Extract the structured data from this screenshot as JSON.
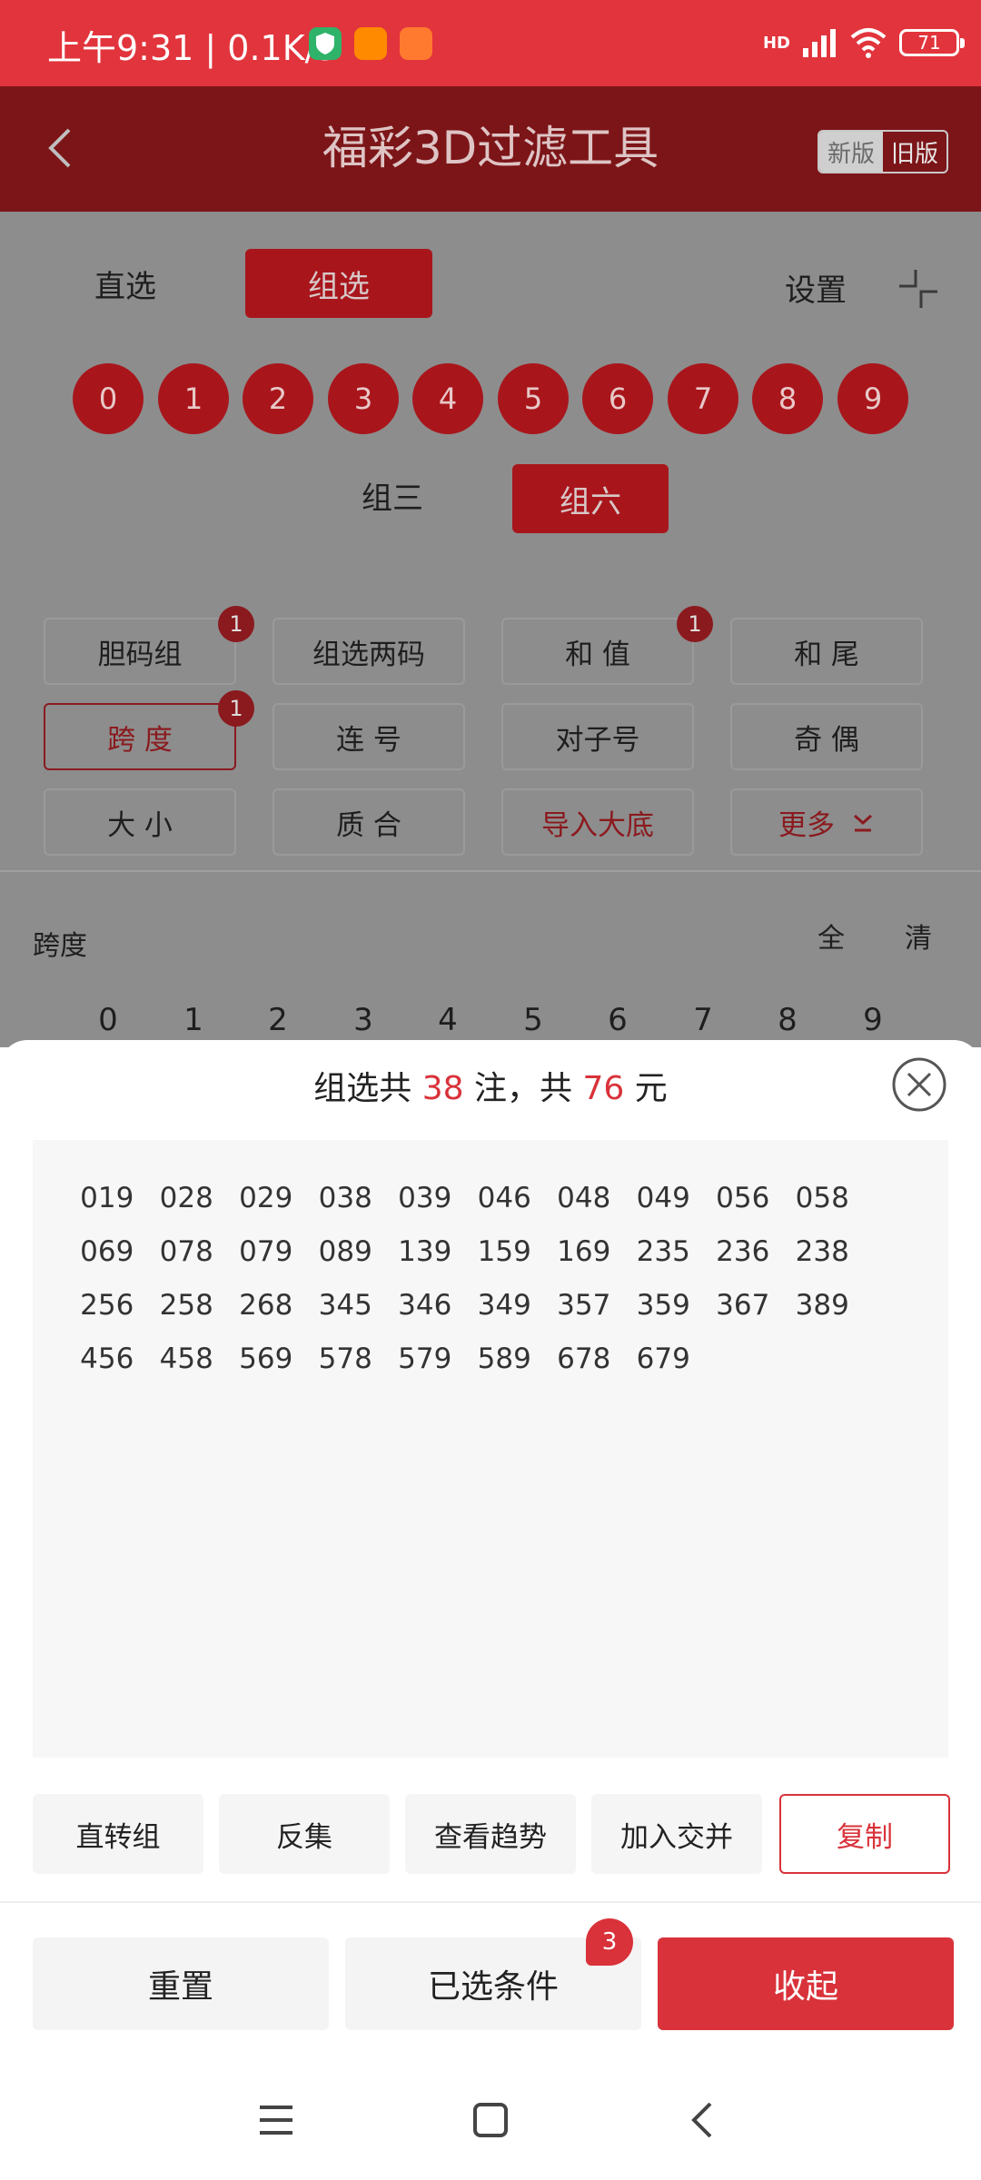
{
  "status_bar": {
    "time": "上午9:31 | 0.1K/s",
    "network": "HD",
    "battery": "71"
  },
  "app_bar": {
    "title": "福彩3D过滤工具",
    "new_version": "新版",
    "old_version": "旧版"
  },
  "mode_tabs": {
    "direct": "直选",
    "group": "组选",
    "settings": "设置"
  },
  "number_balls": [
    "0",
    "1",
    "2",
    "3",
    "4",
    "5",
    "6",
    "7",
    "8",
    "9"
  ],
  "group_type_tabs": {
    "group3": "组三",
    "group6": "组六"
  },
  "filter_chips": [
    {
      "label": "胆码组",
      "badge": "1"
    },
    {
      "label": "组选两码",
      "badge": ""
    },
    {
      "label": "和 值",
      "badge": "1"
    },
    {
      "label": "和 尾",
      "badge": ""
    },
    {
      "label": "跨 度",
      "badge": "1"
    },
    {
      "label": "连 号",
      "badge": ""
    },
    {
      "label": "对子号",
      "badge": ""
    },
    {
      "label": "奇 偶",
      "badge": ""
    },
    {
      "label": "大 小",
      "badge": ""
    },
    {
      "label": "质 合",
      "badge": ""
    },
    {
      "label": "导入大底",
      "badge": ""
    },
    {
      "label": "更多",
      "badge": ""
    }
  ],
  "span_section": {
    "label": "跨度",
    "select_all": "全",
    "clear": "清",
    "digits": [
      "0",
      "1",
      "2",
      "3",
      "4",
      "5",
      "6",
      "7",
      "8",
      "9"
    ]
  },
  "sheet": {
    "title_prefix": "组选共",
    "bet_count": "38",
    "title_mid": "注，共",
    "amount": "76",
    "title_suffix": "元",
    "results": [
      "019",
      "028",
      "029",
      "038",
      "039",
      "046",
      "048",
      "049",
      "056",
      "058",
      "069",
      "078",
      "079",
      "089",
      "139",
      "159",
      "169",
      "235",
      "236",
      "238",
      "256",
      "258",
      "268",
      "345",
      "346",
      "349",
      "357",
      "359",
      "367",
      "389",
      "456",
      "458",
      "569",
      "578",
      "579",
      "589",
      "678",
      "679"
    ],
    "actions": {
      "direct_to_group": "直转组",
      "inverse_set": "反集",
      "view_trend": "查看趋势",
      "add_intersect": "加入交并",
      "copy": "复制"
    },
    "footer": {
      "reset": "重置",
      "selected_conditions": "已选条件",
      "selected_count": "3",
      "collapse": "收起"
    }
  },
  "colors": {
    "status_red": "#e2343c",
    "accent_red": "#d9323a",
    "dim_red": "#a8161c"
  }
}
